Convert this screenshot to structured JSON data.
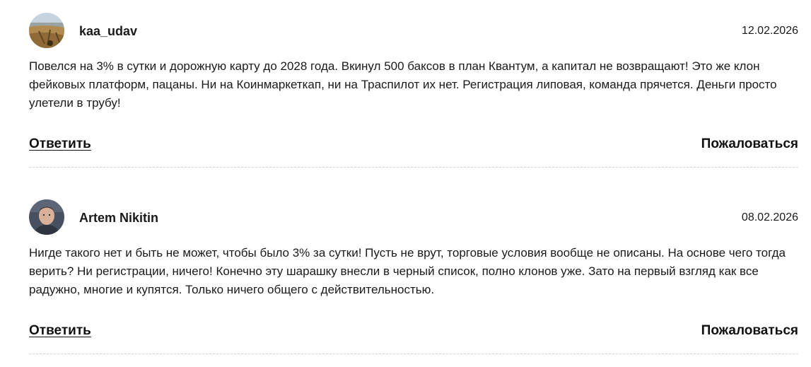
{
  "comments": [
    {
      "author": "kaa_udav",
      "date": "12.02.2026",
      "text": "Повелся на 3% в сутки и дорожную карту до 2028 года. Вкинул 500 баксов в план Квантум, а капитал не возвращают! Это же клон фейковых платформ, пацаны. Ни на Коинмаркеткап, ни на Траспилот их нет. Регистрация липовая, команда прячется. Деньги просто улетели в трубу!",
      "reply_label": "Ответить",
      "report_label": "Пожаловаться",
      "avatar_icon": "landscape-avatar-icon"
    },
    {
      "author": "Artem Nikitin",
      "date": "08.02.2026",
      "text": "Нигде такого нет и быть не может, чтобы было 3% за сутки! Пусть не врут, торговые условия вообще не описаны. На основе чего тогда верить? Ни регистрации, ничего! Конечно эту шарашку внесли в черный список, полно клонов уже. Зато на первый взгляд как все радужно, многие и купятся. Только ничего общего с действительностью.",
      "reply_label": "Ответить",
      "report_label": "Пожаловаться",
      "avatar_icon": "person-avatar-icon"
    }
  ]
}
